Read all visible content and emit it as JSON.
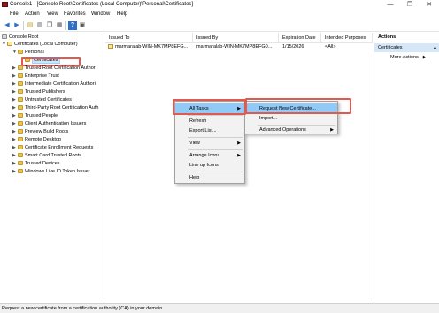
{
  "window": {
    "title": "Console1 - [Console Root\\Certificates (Local Computer)\\Personal\\Certificates]",
    "controls": {
      "minimize": "—",
      "restore": "❐",
      "close": "✕"
    }
  },
  "menu": [
    "File",
    "Action",
    "View",
    "Favorites",
    "Window",
    "Help"
  ],
  "toolbar": [
    "back-icon",
    "forward-icon",
    "up-folder-icon",
    "show-hide-tree-icon",
    "copy-icon",
    "export-list-icon",
    "help-icon",
    "properties-icon"
  ],
  "tree": {
    "root": "Console Root",
    "certificates": "Certificates (Local Computer)",
    "personal": "Personal",
    "personal_certs": "Certificates",
    "stores": [
      "Trusted Root Certification Authori",
      "Enterprise Trust",
      "Intermediate Certification Authori",
      "Trusted Publishers",
      "Untrusted Certificates",
      "Third-Party Root Certification Auth",
      "Trusted People",
      "Client Authentication Issuers",
      "Preview Build Roots",
      "Remote Desktop",
      "Certificate Enrollment Requests",
      "Smart Card Trusted Roots",
      "Trusted Devices",
      "Windows Live ID Token Issuer"
    ]
  },
  "list": {
    "columns": [
      "Issued To",
      "Issued By",
      "Expiration Date",
      "Intended Purposes"
    ],
    "rows": [
      {
        "issued_to": "marmaralab-WIN-MK7MP8EFG...",
        "issued_by": "marmaralab-WIN-MK7MP8EFG0...",
        "expiration": "1/15/2026",
        "purposes": "<All>"
      }
    ]
  },
  "actions": {
    "header": "Actions",
    "section": "Certificates",
    "more": "More Actions"
  },
  "context_menu": {
    "items": [
      "All Tasks",
      "Refresh",
      "Export List...",
      "View",
      "Arrange Icons",
      "Line up Icons",
      "Help"
    ]
  },
  "submenu": {
    "items": [
      "Request New Certificate...",
      "Import...",
      "Advanced Operations"
    ]
  },
  "statusbar": "Request a new certificate from a certification authority (CA) in your domain",
  "colors": {
    "highlight": "#91c9f7",
    "callout": "#e05a50",
    "selection": "#cce8ff"
  }
}
